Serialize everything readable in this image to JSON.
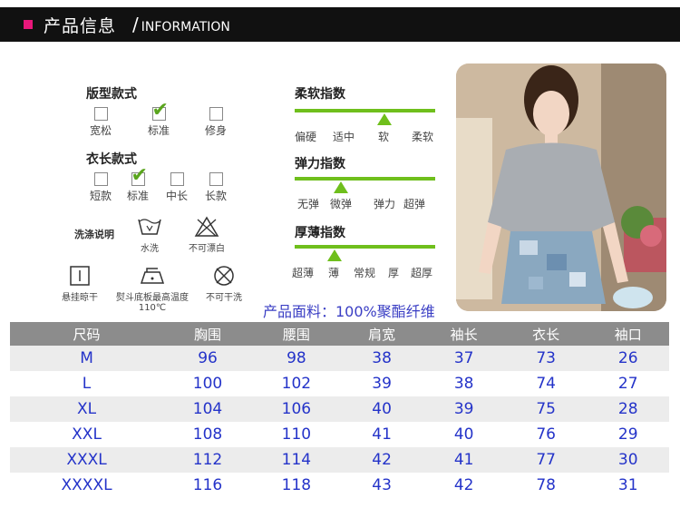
{
  "header": {
    "title_cn": "产品信息",
    "title_en": "INFORMATION",
    "slash": "/"
  },
  "style": {
    "title": "版型款式",
    "options": [
      "宽松",
      "标准",
      "修身"
    ],
    "selected": "标准"
  },
  "length": {
    "title": "衣长款式",
    "options": [
      "短款",
      "标准",
      "中长",
      "长款"
    ],
    "selected": "标准"
  },
  "wash": {
    "title": "洗涤说明",
    "items": [
      "水洗",
      "不可漂白",
      "悬挂晾干",
      "熨斗底板最高温度110℃",
      "不可干洗"
    ]
  },
  "softness": {
    "title": "柔软指数",
    "labels": [
      "偏硬",
      "适中",
      "软",
      "柔软"
    ],
    "level": "软"
  },
  "elasticity": {
    "title": "弹力指数",
    "labels": [
      "无弹",
      "微弹",
      "弹力",
      "超弹"
    ],
    "level": "微弹"
  },
  "thickness": {
    "title": "厚薄指数",
    "labels": [
      "超薄",
      "薄",
      "常规",
      "厚",
      "超厚"
    ],
    "level": "薄"
  },
  "fabric": "产品面料：100%聚酯纤维",
  "table": {
    "headers": [
      "尺码",
      "胸围",
      "腰围",
      "肩宽",
      "袖长",
      "衣长",
      "袖口"
    ],
    "rows": [
      [
        "M",
        "96",
        "98",
        "38",
        "37",
        "73",
        "26"
      ],
      [
        "L",
        "100",
        "102",
        "39",
        "38",
        "74",
        "27"
      ],
      [
        "XL",
        "104",
        "106",
        "40",
        "39",
        "75",
        "28"
      ],
      [
        "XXL",
        "108",
        "110",
        "41",
        "40",
        "76",
        "29"
      ],
      [
        "XXXL",
        "112",
        "114",
        "42",
        "41",
        "77",
        "30"
      ],
      [
        "XXXXL",
        "116",
        "118",
        "43",
        "42",
        "78",
        "31"
      ]
    ]
  },
  "colors": {
    "accent": "#e8177a",
    "green": "#6fbf1c",
    "blue_text": "#2433c9",
    "header_bg": "#111111",
    "table_head": "#8c8c8c"
  }
}
